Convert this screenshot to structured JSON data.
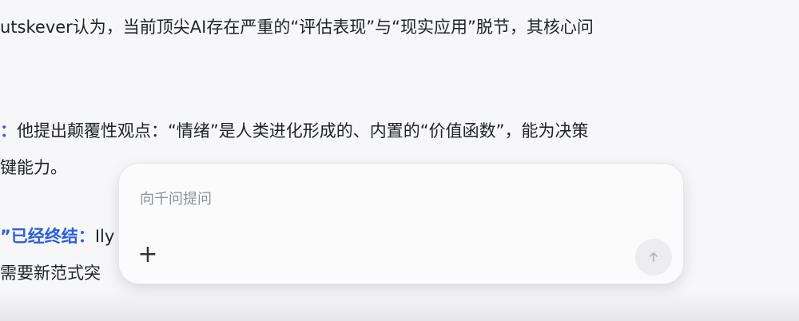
{
  "article": {
    "line1": "utskever认为，当前顶尖AI存在严重的“评估表现”与“现实应用”脱节，其核心问",
    "line2_strong": "：",
    "line2_rest": "他提出颠覆性观点：“情绪”是人类进化形成的、内置的“价值函数”，能为决策",
    "line3": "键能力。",
    "line4_strong": "”已经终结：",
    "line4_rest": "Ily",
    "line5": "需要新范式突"
  },
  "composer": {
    "placeholder": "向千问提问",
    "add_icon": "+",
    "send_icon": "arrow-up-icon"
  },
  "colors": {
    "accent": "#2b5fd9",
    "background": "#f7f7f9"
  }
}
